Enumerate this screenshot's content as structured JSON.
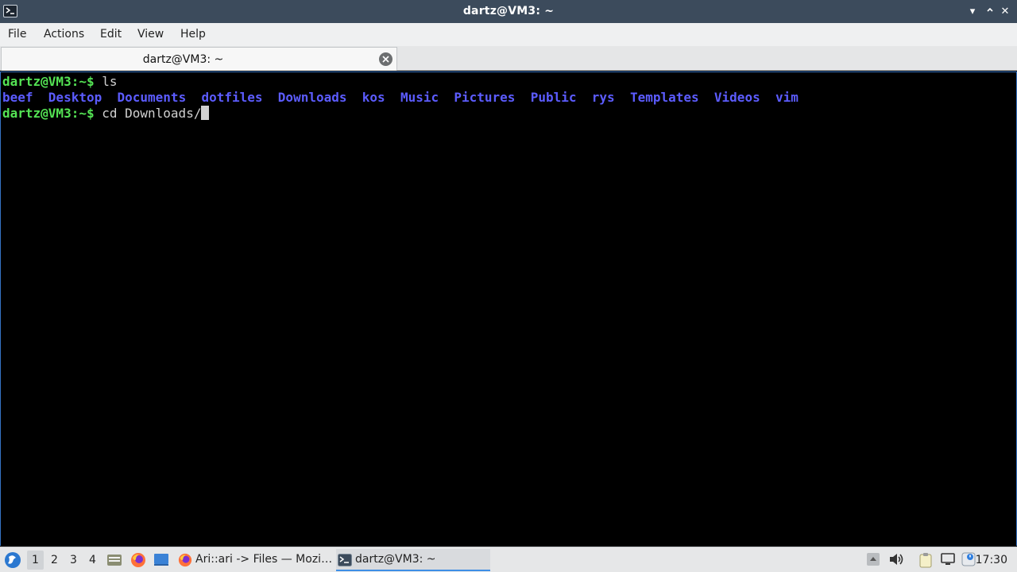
{
  "window": {
    "title": "dartz@VM3: ~",
    "minimize_glyph": "▾",
    "maximize_glyph": "⌃",
    "close_glyph": "✕"
  },
  "menu": {
    "items": [
      "File",
      "Actions",
      "Edit",
      "View",
      "Help"
    ]
  },
  "tabs": [
    {
      "label": "dartz@VM3: ~",
      "active": true
    }
  ],
  "terminal": {
    "prompt": "dartz@VM3:~$",
    "line1_cmd": " ls",
    "ls_output": [
      "beef",
      "Desktop",
      "Documents",
      "dotfiles",
      "Downloads",
      "kos",
      "Music",
      "Pictures",
      "Public",
      "rys",
      "Templates",
      "Videos",
      "vim"
    ],
    "line3_cmd": " cd Downloads/",
    "colors": {
      "prompt": "#54e354",
      "dir": "#5c5cff",
      "text": "#d0d0d0",
      "background": "#000000"
    }
  },
  "taskbar": {
    "workspaces": [
      "1",
      "2",
      "3",
      "4"
    ],
    "active_workspace": "1",
    "launchers": [
      "file-manager-icon",
      "firefox-icon",
      "desktop-icon"
    ],
    "tasks": [
      {
        "label": "Ari::ari -> Files — Mozi…",
        "icon": "firefox-icon",
        "active": false
      },
      {
        "label": "dartz@VM3: ~",
        "icon": "terminal-icon",
        "active": true
      }
    ],
    "tray_icons": [
      "tray-up-arrow-icon",
      "volume-icon",
      "clipboard-icon",
      "network-icon",
      "notification-icon"
    ],
    "clock": "17:30"
  }
}
